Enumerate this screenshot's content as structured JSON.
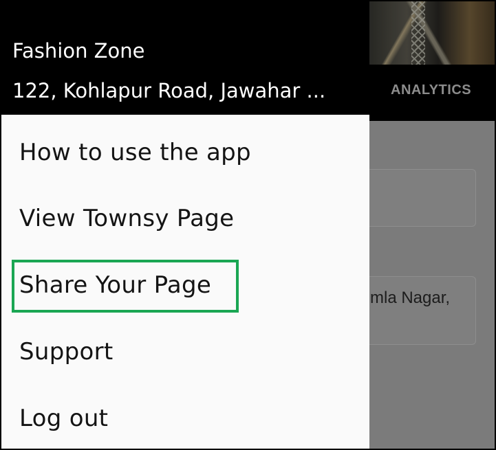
{
  "header": {
    "store_name": "Fashion Zone",
    "store_address": "122, Kohlapur Road, Jawahar ..."
  },
  "background": {
    "tab_label": "ANALYTICS",
    "field_text": "mla Nagar,"
  },
  "drawer": {
    "items": [
      {
        "label": "How to use the app"
      },
      {
        "label": "View Townsy Page"
      },
      {
        "label": "Share Your Page",
        "highlighted": true
      },
      {
        "label": "Support"
      },
      {
        "label": "Log out"
      }
    ]
  },
  "colors": {
    "header_bg": "#000000",
    "drawer_bg": "#fafafa",
    "highlight": "#1aa653",
    "scrim": "#7b7b7b"
  }
}
